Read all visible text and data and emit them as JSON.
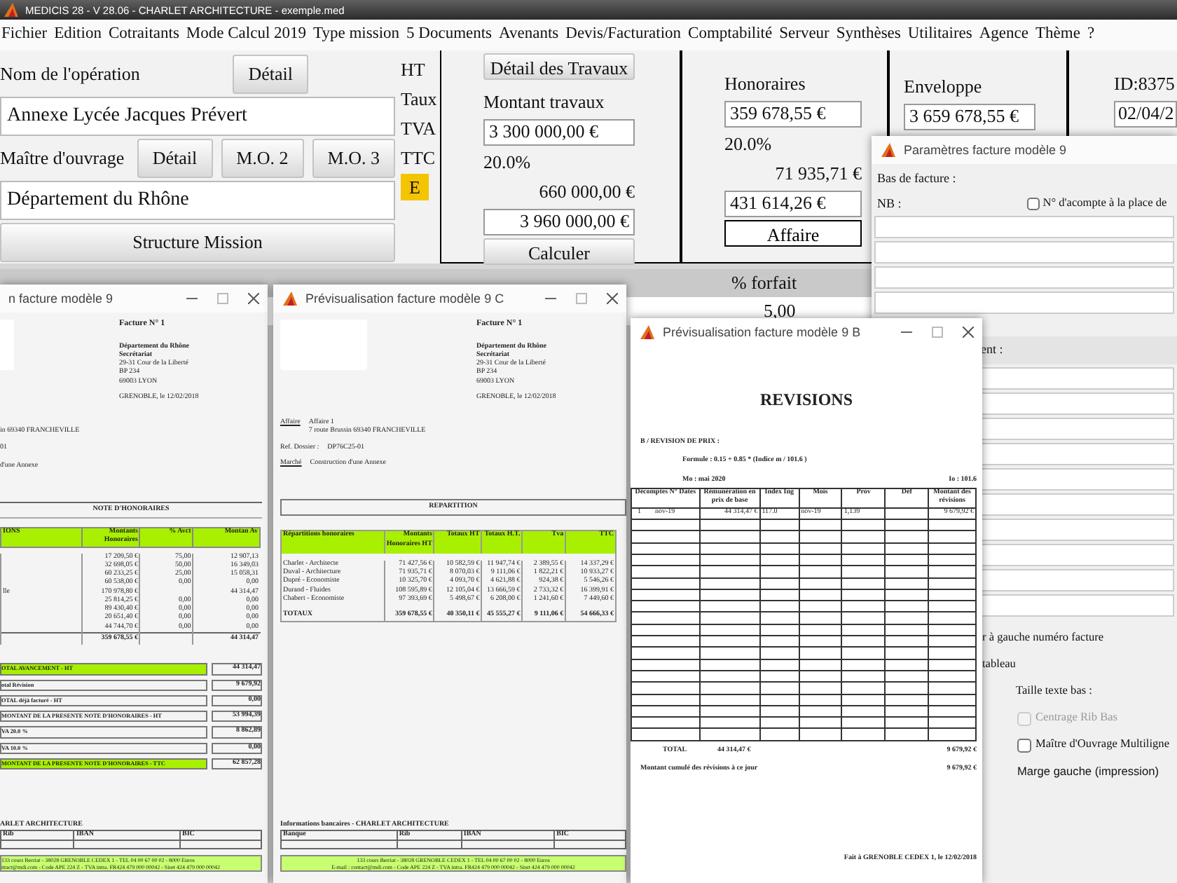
{
  "app": {
    "title": "MEDICIS 28  - V 28.06 - CHARLET ARCHITECTURE - exemple.med"
  },
  "menu": [
    "Fichier",
    "Edition",
    "Cotraitants",
    "Mode Calcul 2019",
    "Type mission",
    "5 Documents",
    "Avenants",
    "Devis/Facturation",
    "Comptabilité",
    "Serveur",
    "Synthèses",
    "Utilitaires",
    "Agence",
    "Thème",
    "?"
  ],
  "operation": {
    "label": "Nom de l'opération",
    "detail_button": "Détail",
    "value": "Annexe Lycée Jacques Prévert"
  },
  "owner": {
    "label": "Maître d'ouvrage",
    "buttons": [
      "Détail",
      "M.O. 2",
      "M.O. 3"
    ],
    "value": "Département du Rhône"
  },
  "structure_button": "Structure Mission",
  "row_labels": [
    "HT",
    "Taux",
    "TVA",
    "TTC"
  ],
  "mode_badge": "E",
  "works": {
    "button": "Détail des Travaux",
    "label": "Montant travaux",
    "ht": "3 300 000,00 €",
    "rate": "20.0%",
    "vat": "660 000,00 €",
    "ttc": "3 960 000,00 €",
    "calc_button": "Calculer"
  },
  "fees": {
    "label": "Honoraires",
    "ht": "359 678,55 €",
    "rate": "20.0%",
    "vat": "71 935,71 €",
    "ttc": "431 614,26 €",
    "button": "Affaire"
  },
  "envelope": {
    "label": "Enveloppe",
    "value": "3 659 678,55 €"
  },
  "record": {
    "id": "ID:8375",
    "date": "02/04/2"
  },
  "phase_table": {
    "header": "% forfait",
    "value": "5,00"
  },
  "settings_window": {
    "title": "Paramètres facture modèle 9",
    "section": "Bas de facture :",
    "nb_label": "NB :",
    "nb_option": {
      "label": "N° d'acompte à la place de",
      "checked": false
    },
    "second_label": "ent :",
    "options": [
      {
        "kind": "cut_text",
        "label": "r à gauche numéro facture"
      },
      {
        "kind": "cut_text",
        "label": "tableau"
      },
      {
        "kind": "label",
        "label": "Taille texte bas :"
      },
      {
        "kind": "checkbox",
        "label": "Centrage Rib Bas",
        "checked": false,
        "disabled": true
      },
      {
        "kind": "checkbox",
        "label": "Maître d'Ouvrage Multiligne",
        "checked": false,
        "disabled": false
      },
      {
        "kind": "sans_label",
        "label": "Marge gauche (impression)"
      }
    ]
  },
  "notes_window": {
    "title": "n facture modèle 9",
    "invoice_no": "Facture N° 1",
    "address": [
      "Département du Rhône",
      "Secrétariat",
      "29-31 Cour de la Liberté",
      "BP 234",
      "69003   LYON"
    ],
    "place_date": "GRENOBLE, le 12/02/2018",
    "info": [
      "in 69340 FRANCHEVILLE",
      "01",
      "d'une Annexe"
    ],
    "section": "NOTE D'HONORAIRES",
    "columns": [
      "IONS",
      "Montants Honoraires",
      "% Avct",
      "Montan Av"
    ],
    "rows": [
      {
        "amount": "17 209,50 €",
        "pct": "75,00",
        "progress": "12 907,13"
      },
      {
        "amount": "32 698,05 €",
        "pct": "50,00",
        "progress": "16 349,03"
      },
      {
        "amount": "60 233,25 €",
        "pct": "25,00",
        "progress": "15 058,31"
      },
      {
        "amount": "60 538,00 €",
        "pct": "0,00",
        "progress": "0,00"
      },
      {
        "label": "lle",
        "amount": "170 978,80 €",
        "progress": "44 314,47"
      },
      {
        "amount": "25 814,25 €",
        "pct": "0,00",
        "progress": "0,00"
      },
      {
        "amount": "89 430,40 €",
        "pct": "0,00",
        "progress": "0,00"
      },
      {
        "amount": "20 651,40 €",
        "pct": "0,00",
        "progress": "0,00"
      },
      {
        "amount": "44 744,70 €",
        "pct": "0,00",
        "progress": "0,00"
      }
    ],
    "total": {
      "amount": "359 678,55 €",
      "progress": "44 314,47"
    },
    "summary": [
      {
        "label": "OTAL AVANCEMENT - HT",
        "value": "44 314,47",
        "highlight": true
      },
      {
        "label": "otal Révision",
        "value": "9 679,92",
        "highlight": false
      },
      {
        "label": "OTAL déjà facturé - HT",
        "value": "0,00",
        "highlight": false
      },
      {
        "label": "MONTANT DE LA PRESENTE NOTE D'HONORAIRES - HT",
        "value": "53 994,39",
        "highlight": false
      },
      {
        "label": "VA 20.0 %",
        "value": "8 862,89",
        "highlight": false
      },
      {
        "label": "VA 10.0 %",
        "value": "0,00",
        "highlight": false
      },
      {
        "label": "MONTANT DE LA PRESENTE NOTE D'HONORAIRES - TTC",
        "value": "62 857,28",
        "highlight": true
      }
    ],
    "bank_title": "ARLET ARCHITECTURE",
    "bank_columns": [
      "Rib",
      "IBAN",
      "BIC"
    ],
    "footer": [
      "133 cours Berriat - 38028 GRENOBLE CEDEX 1 - TEL 04 00 67 00 02 - 8000 Euros",
      "ntact@mdi.com - Code APE 224 Z - TVA intra. FR424 479 000 00042 - Siret 424 479 000 00042"
    ]
  },
  "split_window": {
    "title": "Prévisualisation facture modèle 9 C",
    "invoice_no": "Facture N° 1",
    "address": [
      "Département du Rhône",
      "Secrétariat",
      "29-31 Cour de la Liberté",
      "BP 234",
      "69003   LYON"
    ],
    "place_date": "GRENOBLE, le 12/02/2018",
    "details": [
      {
        "label": "Affaire",
        "underlined": true,
        "lines": [
          "Affaire 1",
          "7 route Brussin 69340 FRANCHEVILLE"
        ]
      },
      {
        "label": "Ref. Dossier :",
        "underlined": false,
        "lines": [
          "DP76C25-01"
        ]
      },
      {
        "label": "Marché",
        "underlined": true,
        "lines": [
          "Construction d'une Annexe"
        ]
      }
    ],
    "section": "REPARTITION",
    "columns": [
      "Répartitions honoraires",
      "Montants Honoraires HT",
      "Totaux HT",
      "Totaux H.T.",
      "Tva",
      "TTC"
    ],
    "rows": [
      [
        "Charlet - Architecte",
        "71 427,56 €",
        "10 582,59 €",
        "11 947,74 €",
        "2 389,55 €",
        "14 337,29 €"
      ],
      [
        "Duval - Architecture",
        "71 935,71 €",
        "8 070,03 €",
        "9 111,06 €",
        "1 822,21 €",
        "10 933,27 €"
      ],
      [
        "Dupré - Economiste",
        "10 325,70 €",
        "4 093,70 €",
        "4 621,88 €",
        "924,38 €",
        "5 546,26 €"
      ],
      [
        "Durand - Fluides",
        "108 595,89 €",
        "12 105,04 €",
        "13 666,59 €",
        "2 733,32 €",
        "16 399,91 €"
      ],
      [
        "Chabert - Economiste",
        "97 393,69 €",
        "5 498,67 €",
        "6 208,00 €",
        "1 241,60 €",
        "7 449,60 €"
      ]
    ],
    "total": [
      "TOTAUX",
      "359 678,55 €",
      "40 350,11 €",
      "45 555,27 €",
      "9 111,06 €",
      "54 666,33 €"
    ],
    "bank_title": "Informations bancaires - CHARLET ARCHITECTURE",
    "bank_columns": [
      "Banque",
      "Rib",
      "IBAN",
      "BIC"
    ],
    "footer": [
      "133 cours Berriat - 38028 GRENOBLE CEDEX 1 - TEL 04 00 67 00 02 - 8000 Euros",
      "E-mail : contact@mdi.com - Code APE 224 Z - TVA intra. FR424 479 000 00042 - Siret 424 479 000 00042"
    ]
  },
  "revisions_window": {
    "title": "Prévisualisation facture modèle 9 B",
    "heading": "REVISIONS",
    "subheading": "B / REVISION DE PRIX :",
    "formula": "Formule : 0.15  +  0.85  *  (Indice m / 101.6 )",
    "mo": "Mo : mai 2020",
    "io": "Io : 101.6",
    "columns": [
      "Décomptes N° Dates",
      "Rémunération en prix de base",
      "Index Ing",
      "Mois",
      "Prov",
      "Déf",
      "Montant des révisions"
    ],
    "rows": [
      {
        "no": "1",
        "date": "nov-19",
        "base": "44 314,47 €",
        "index": "117.0",
        "month": "nov-19",
        "prov": "1,139",
        "amount": "9 679,92 €"
      }
    ],
    "total_label": "TOTAL",
    "total_base": "44 314,47 €",
    "total_amount": "9 679,92 €",
    "cumulative_label": "Montant cumulé des révisions à ce jour",
    "cumulative_amount": "9 679,92 €",
    "signature": "Fait à GRENOBLE CEDEX 1, le 12/02/2018"
  }
}
